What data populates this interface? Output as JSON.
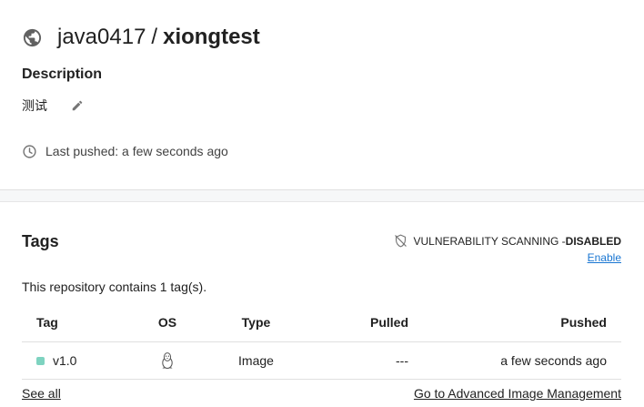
{
  "repo": {
    "namespace": "java0417",
    "separator": "/",
    "name": "xiongtest",
    "icon": "globe-icon"
  },
  "description": {
    "heading": "Description",
    "text": "测试",
    "edit_icon": "pencil-icon"
  },
  "last_pushed": {
    "text": "Last pushed: a few seconds ago",
    "icon": "clock-icon"
  },
  "tags_section": {
    "heading": "Tags",
    "vulnerability": {
      "label": "VULNERABILITY SCANNING - ",
      "status": "DISABLED",
      "action": "Enable",
      "icon": "shield-off-icon"
    },
    "count_text": "This repository contains 1 tag(s).",
    "columns": [
      "Tag",
      "OS",
      "Type",
      "Pulled",
      "Pushed"
    ],
    "rows": [
      {
        "tag": "v1.0",
        "os": "linux-icon",
        "type": "Image",
        "pulled": "---",
        "pushed": "a few seconds ago",
        "dot_color": "#7ed3c0"
      }
    ],
    "see_all": "See all",
    "advanced_link": "Go to Advanced Image Management"
  },
  "colors": {
    "link": "#1976d2",
    "divider": "#e0e0e0",
    "icon_grey": "#757575"
  }
}
